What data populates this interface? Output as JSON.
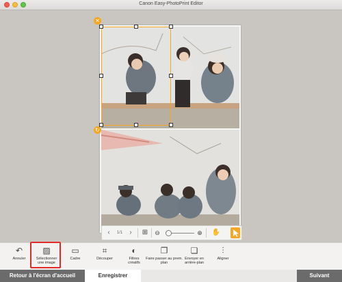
{
  "window": {
    "title": "Canon Easy-PhotoPrint Editor"
  },
  "navigator": {
    "page_indicator": "1/1"
  },
  "toolbar": {
    "undo": "Annuler",
    "select_image": "Sélectionner une image",
    "frame": "Cadre",
    "crop": "Découper",
    "filters": "Filtres créatifs",
    "bring_forward": "Faire passer au prem. plan",
    "send_backward": "Envoyer en arrière-plan",
    "align": "Aligner"
  },
  "footer": {
    "back": "Retour à l'écran d'accueil",
    "save": "Enregistrer",
    "next": "Suivant"
  },
  "colors": {
    "accent": "#f5a623",
    "highlight": "#e3282a",
    "button_dark": "#6b6b6b"
  }
}
